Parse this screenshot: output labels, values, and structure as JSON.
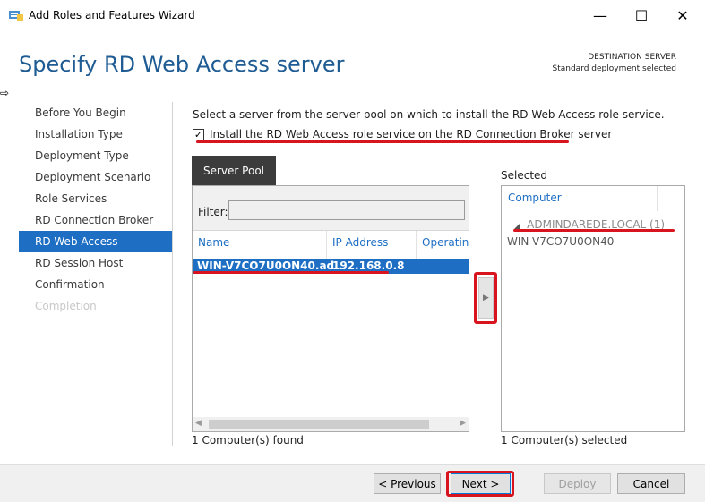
{
  "window": {
    "title": "Add Roles and Features Wizard",
    "minimize_glyph": "—",
    "maximize_glyph": "☐",
    "close_glyph": "✕"
  },
  "header": {
    "title": "Specify RD Web Access server",
    "destination_label": "DESTINATION SERVER",
    "destination_value": "Standard deployment selected"
  },
  "nav": {
    "items": [
      {
        "label": "Before You Begin",
        "state": "normal"
      },
      {
        "label": "Installation Type",
        "state": "normal"
      },
      {
        "label": "Deployment Type",
        "state": "normal"
      },
      {
        "label": "Deployment Scenario",
        "state": "normal"
      },
      {
        "label": "Role Services",
        "state": "normal"
      },
      {
        "label": "RD Connection Broker",
        "state": "normal"
      },
      {
        "label": "RD Web Access",
        "state": "active"
      },
      {
        "label": "RD Session Host",
        "state": "normal"
      },
      {
        "label": "Confirmation",
        "state": "normal"
      },
      {
        "label": "Completion",
        "state": "disabled"
      }
    ]
  },
  "content": {
    "intro": "Select a server from the server pool on which to install the RD Web Access role service.",
    "checkbox_glyph": "✓",
    "checkbox_label": "Install the RD Web Access role service on the RD Connection Broker server"
  },
  "pool": {
    "tab_label": "Server Pool",
    "filter_label": "Filter:",
    "filter_value": "",
    "columns": {
      "name": "Name",
      "ip": "IP Address",
      "os": "Operating"
    },
    "rows": [
      {
        "name": "WIN-V7CO7U0ON40.ad...",
        "ip": "192.168.0.8"
      }
    ],
    "count": "1 Computer(s) found"
  },
  "move_button_glyph": "▶",
  "selected": {
    "label": "Selected",
    "column": "Computer",
    "group_caret": "◢",
    "group_label": "ADMINDAREDE.LOCAL (1)",
    "item": "WIN-V7CO7U0ON40",
    "count": "1 Computer(s) selected"
  },
  "footer": {
    "previous": "< Previous",
    "next": "Next >",
    "deploy": "Deploy",
    "cancel": "Cancel"
  },
  "colors": {
    "accent": "#1e6fc4",
    "title_blue": "#1f5c93",
    "annotation_red": "#d8141e"
  }
}
